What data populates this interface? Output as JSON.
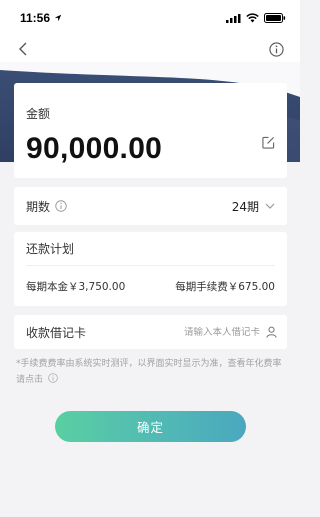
{
  "status_bar": {
    "time": "11:56"
  },
  "amount_card": {
    "label": "金额",
    "value": "90,000.00"
  },
  "period": {
    "label": "期数",
    "value": "24期"
  },
  "plan": {
    "title": "还款计划",
    "principal": "每期本金￥3,750.00",
    "fee": "每期手续费￥675.00"
  },
  "debit_card": {
    "label": "收款借记卡",
    "placeholder": "请输入本人借记卡"
  },
  "notice": "*手续费费率由系统实时测评，以界面实时显示为准，查看年化费率请点击",
  "confirm": {
    "label": "确定"
  },
  "colors": {
    "header": "#34466c",
    "accent_start": "#59cfa2",
    "accent_end": "#4aa8be",
    "background": "#f3f3f5"
  },
  "icons": {
    "back": "chevron-left-icon",
    "info": "info-circle-icon",
    "edit": "edit-icon",
    "dropdown": "chevron-down-icon",
    "user": "user-icon",
    "location": "location-arrow-icon",
    "signal": "signal-icon",
    "wifi": "wifi-icon",
    "battery": "battery-icon"
  }
}
